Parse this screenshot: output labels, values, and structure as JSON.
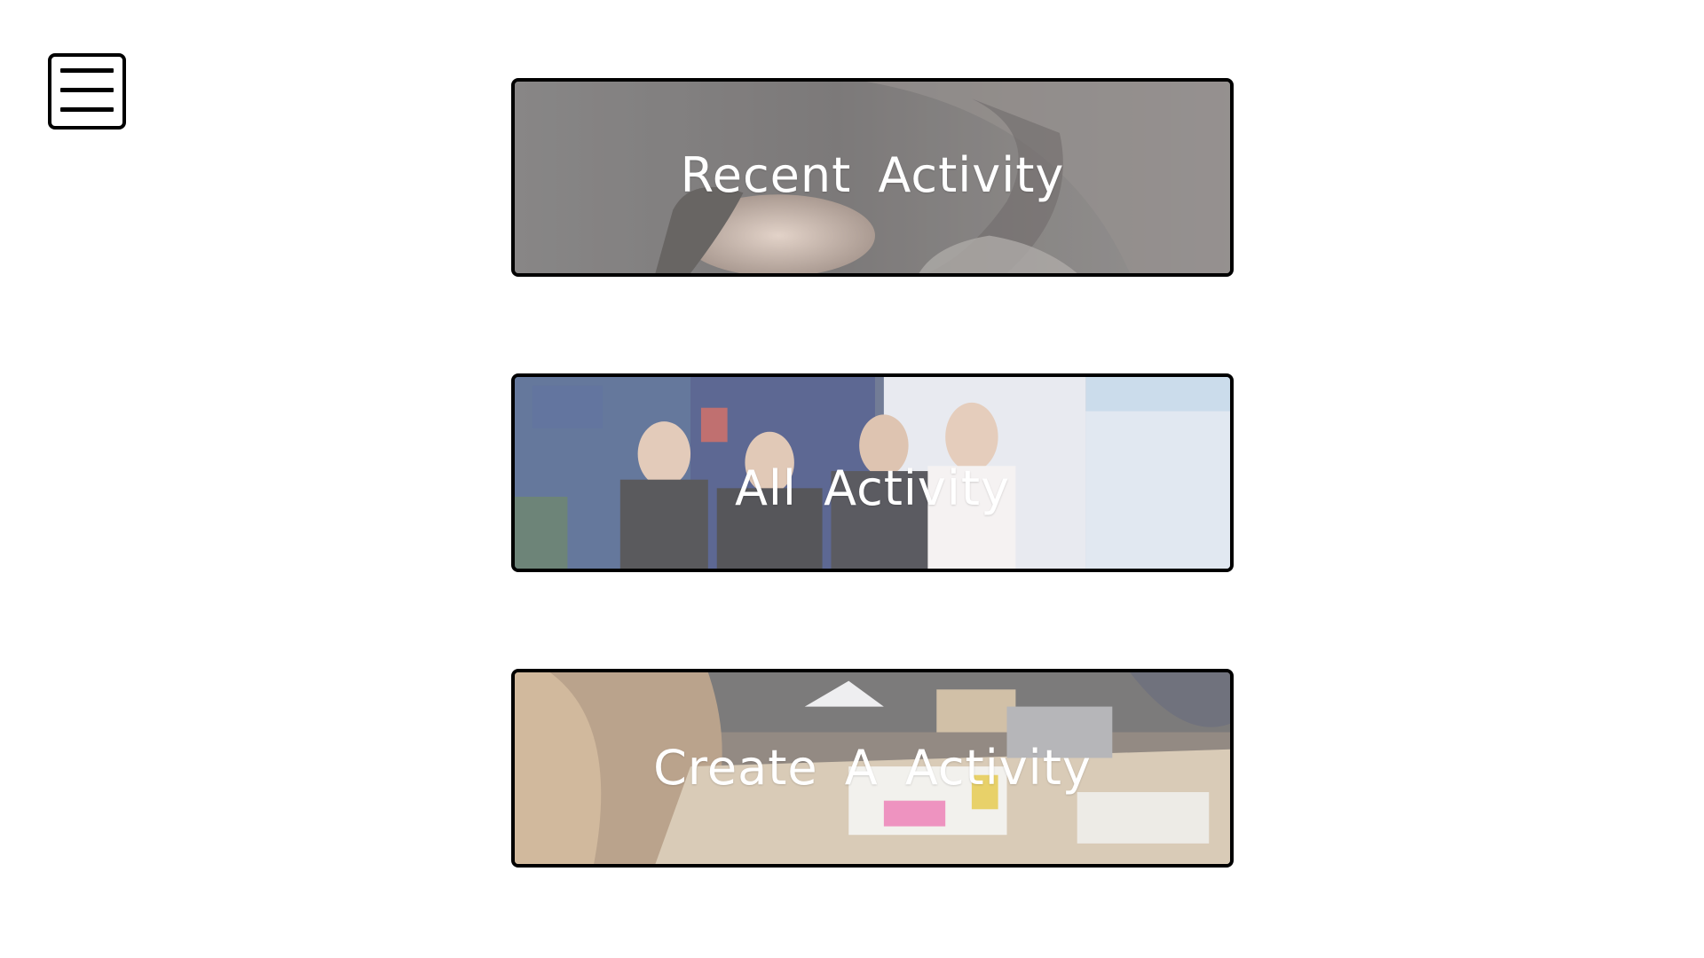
{
  "menu": {
    "icon": "hamburger-menu-icon"
  },
  "cards": [
    {
      "label": "Recent  Activity",
      "image": "person-lying-down-photo"
    },
    {
      "label": "All  Activity",
      "image": "group-at-expo-booth-photo"
    },
    {
      "label": "Create  A  Activity",
      "image": "workshop-table-photo"
    }
  ]
}
